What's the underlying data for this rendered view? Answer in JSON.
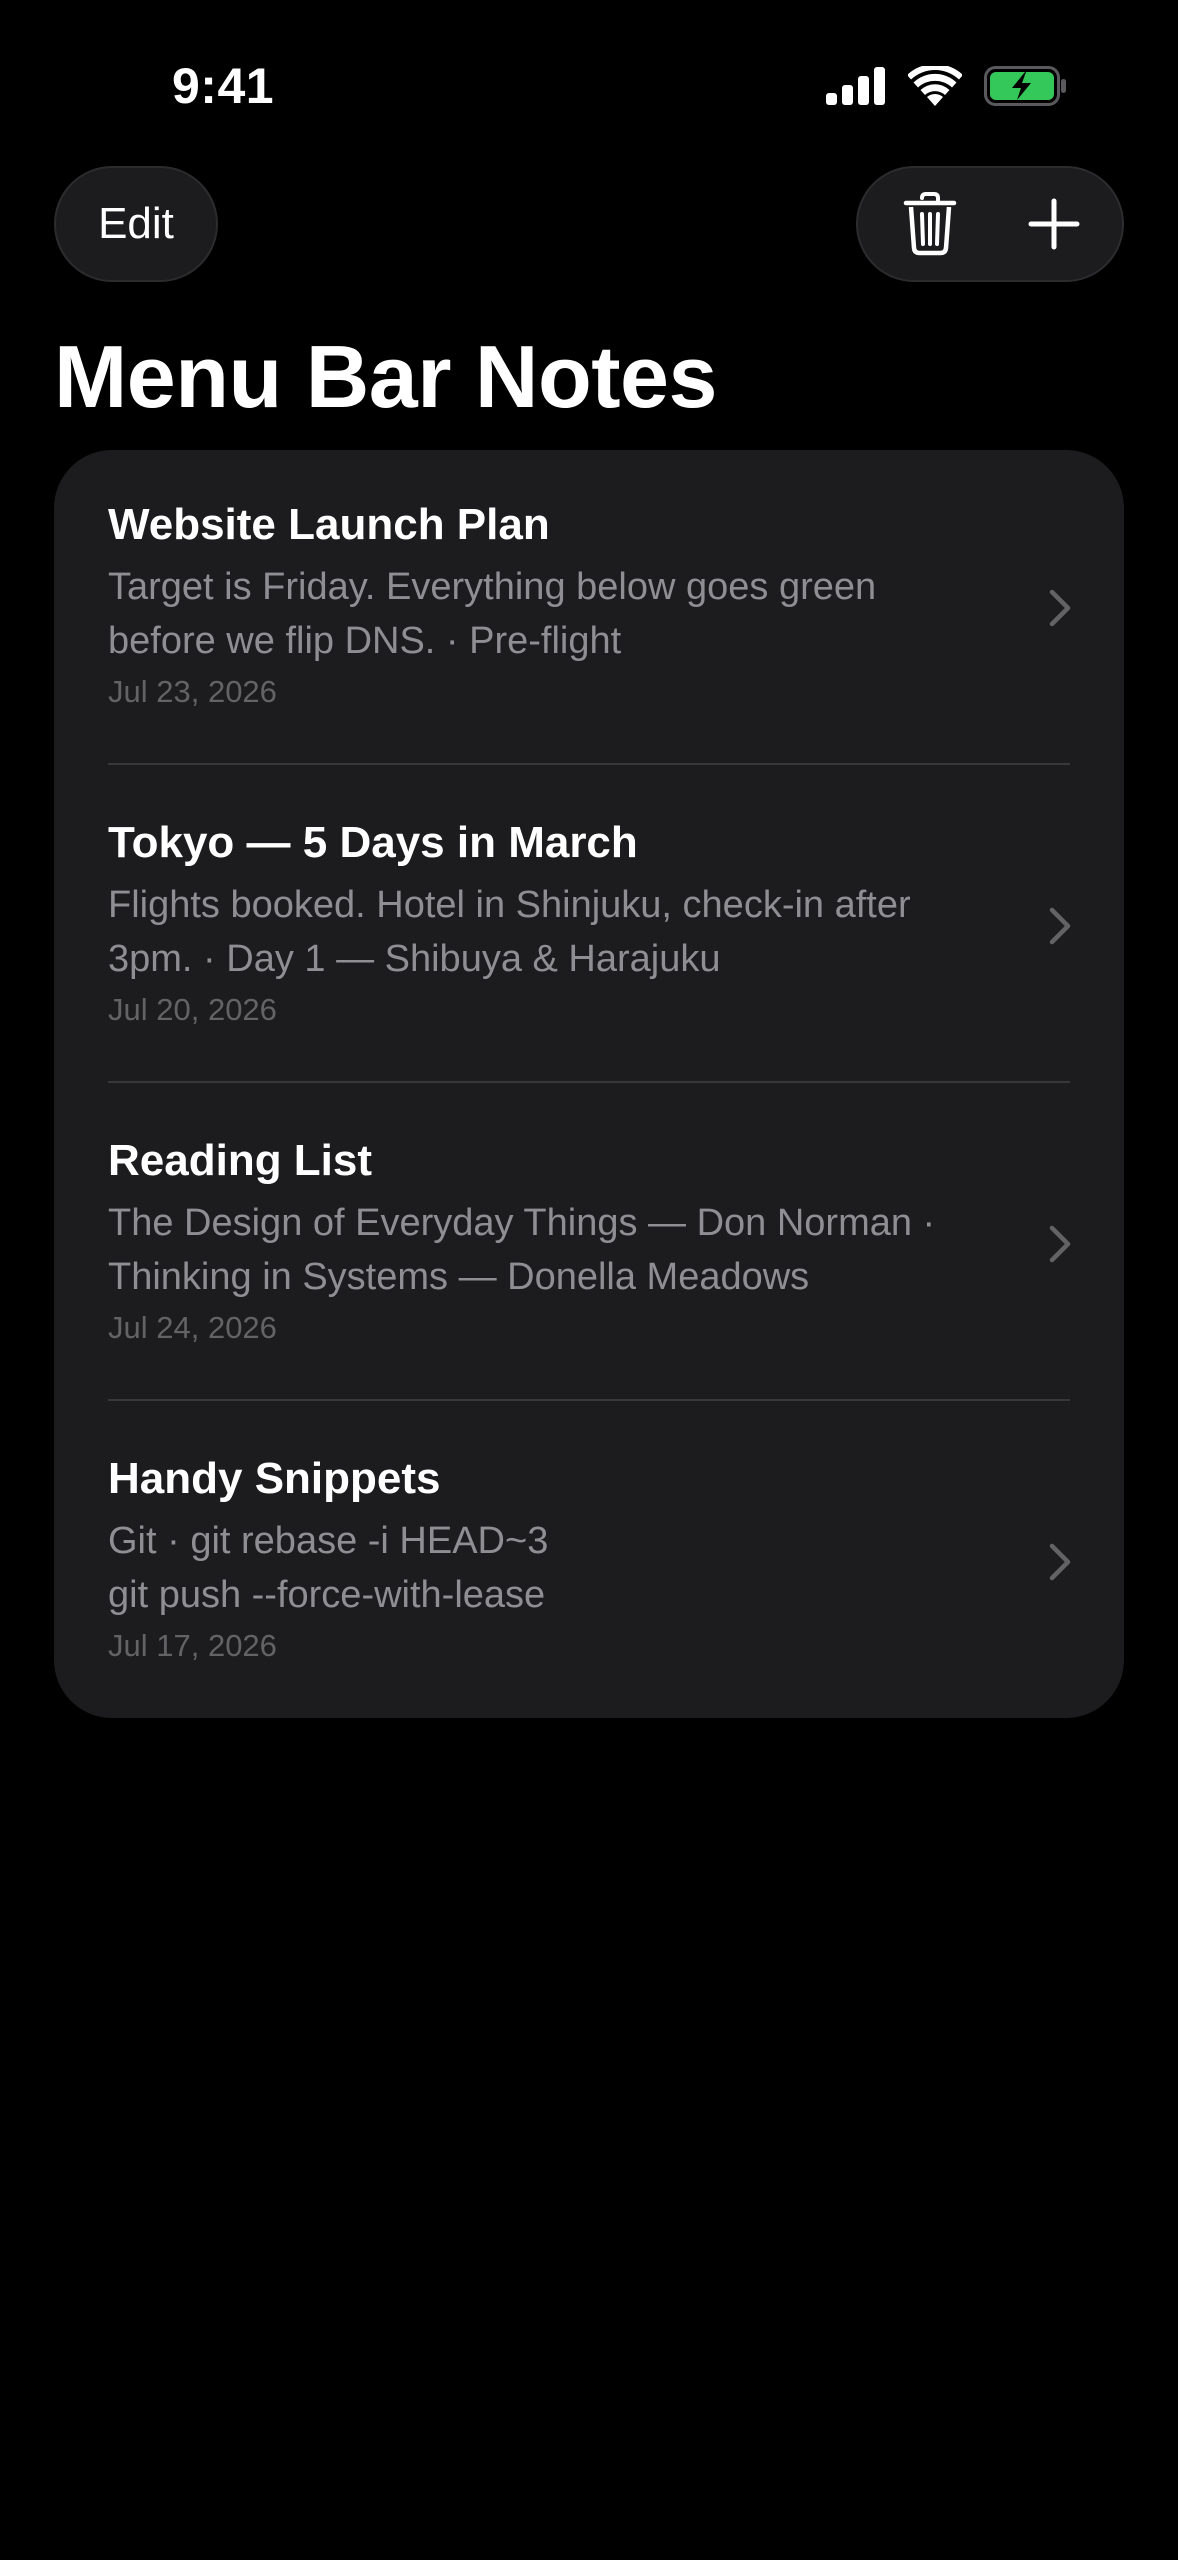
{
  "status_bar": {
    "time": "9:41",
    "icons": [
      "cellular-signal-icon",
      "wifi-icon",
      "battery-charging-icon"
    ],
    "battery_color": "#34c759"
  },
  "toolbar": {
    "edit_label": "Edit",
    "trash_icon": "trash-icon",
    "add_icon": "plus-icon"
  },
  "page": {
    "title": "Menu Bar Notes"
  },
  "notes": [
    {
      "title": "Website Launch Plan",
      "preview_line1": "Target is Friday. Everything below goes green",
      "preview_line2": "before we flip DNS. · Pre-flight",
      "date": "Jul 23, 2026"
    },
    {
      "title": "Tokyo — 5 Days in March",
      "preview_line1": "Flights booked. Hotel in Shinjuku, check-in after",
      "preview_line2": "3pm. · Day 1 — Shibuya & Harajuku",
      "date": "Jul 20, 2026"
    },
    {
      "title": "Reading List",
      "preview_line1": "The Design of Everyday Things — Don Norman ·",
      "preview_line2": "Thinking in Systems — Donella Meadows",
      "date": "Jul 24, 2026"
    },
    {
      "title": "Handy Snippets",
      "preview_line1": "Git · git rebase -i HEAD~3",
      "preview_line2": "git push --force-with-lease",
      "date": "Jul 17, 2026"
    }
  ]
}
